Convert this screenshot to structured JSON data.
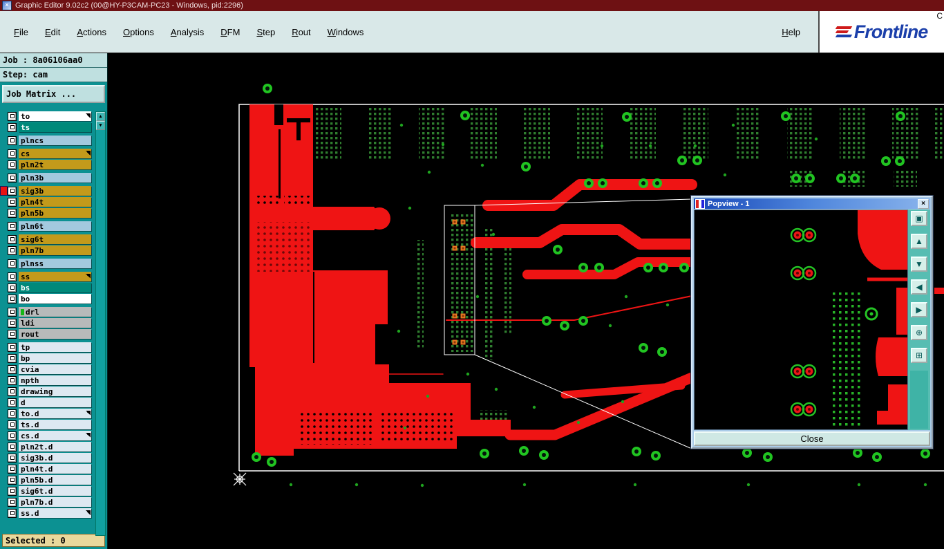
{
  "titlebar": {
    "title": "Graphic Editor 9.02c2 (00@HY-P3CAM-PC23 - Windows, pid:2296)"
  },
  "icons": {
    "app": "×",
    "close": "×",
    "scroll_up": "▲",
    "scroll_down": "▼"
  },
  "menubar": {
    "items": [
      {
        "label": "File",
        "key": "F"
      },
      {
        "label": "Edit",
        "key": "E"
      },
      {
        "label": "Actions",
        "key": "A"
      },
      {
        "label": "Options",
        "key": "O"
      },
      {
        "label": "Analysis",
        "key": "A"
      },
      {
        "label": "DFM",
        "key": "D"
      },
      {
        "label": "Step",
        "key": "S"
      },
      {
        "label": "Rout",
        "key": "R"
      },
      {
        "label": "Windows",
        "key": "W"
      }
    ],
    "help": {
      "label": "Help",
      "key": "H"
    }
  },
  "logo": {
    "brand": "Frontline",
    "partial": "C"
  },
  "sidebar": {
    "job_label": "Job : 8a06106aa0",
    "step_label": "Step: cam",
    "job_matrix_label": "Job Matrix ...",
    "selected_label": "Selected : 0",
    "colors": {
      "gold": "#c39a1b",
      "teal": "#00897a",
      "blue": "#a3c9de",
      "white": "#ffffff",
      "gray": "#b7baba",
      "pale": "#dde8f1"
    },
    "layers": [
      {
        "name": "to",
        "color": "white",
        "mark": true
      },
      {
        "name": "ts",
        "color": "teal",
        "fg": "#ffffff"
      },
      {
        "name": "plncs",
        "color": "blue",
        "gap": true
      },
      {
        "name": "cs",
        "color": "gold",
        "gap": true,
        "mark": true
      },
      {
        "name": "pln2t",
        "color": "gold"
      },
      {
        "name": "pln3b",
        "color": "blue",
        "gap": true
      },
      {
        "name": "sig3b",
        "color": "gold",
        "gap": true,
        "active": true
      },
      {
        "name": "pln4t",
        "color": "gold"
      },
      {
        "name": "pln5b",
        "color": "gold"
      },
      {
        "name": "pln6t",
        "color": "blue",
        "gap": true
      },
      {
        "name": "sig6t",
        "color": "gold",
        "gap": true
      },
      {
        "name": "pln7b",
        "color": "gold"
      },
      {
        "name": "plnss",
        "color": "blue",
        "gap": true
      },
      {
        "name": "ss",
        "color": "gold",
        "gap": true,
        "mark": true
      },
      {
        "name": "bs",
        "color": "teal",
        "fg": "#ffffff"
      },
      {
        "name": "bo",
        "color": "white"
      },
      {
        "name": "drl",
        "color": "gray",
        "gap": true,
        "chip": "#16b816"
      },
      {
        "name": "ldi",
        "color": "gray"
      },
      {
        "name": "rout",
        "color": "gray"
      },
      {
        "name": "tp",
        "color": "pale",
        "gap": true
      },
      {
        "name": "bp",
        "color": "pale"
      },
      {
        "name": "cvia",
        "color": "pale"
      },
      {
        "name": "npth",
        "color": "pale"
      },
      {
        "name": "drawing",
        "color": "pale"
      },
      {
        "name": "d",
        "color": "pale"
      },
      {
        "name": "to.d",
        "color": "pale",
        "mark": true
      },
      {
        "name": "ts.d",
        "color": "pale"
      },
      {
        "name": "cs.d",
        "color": "pale",
        "mark": true
      },
      {
        "name": "pln2t.d",
        "color": "pale"
      },
      {
        "name": "sig3b.d",
        "color": "pale"
      },
      {
        "name": "pln4t.d",
        "color": "pale"
      },
      {
        "name": "pln5b.d",
        "color": "pale"
      },
      {
        "name": "sig6t.d",
        "color": "pale"
      },
      {
        "name": "pln7b.d",
        "color": "pale"
      },
      {
        "name": "ss.d",
        "color": "pale",
        "mark": true
      }
    ]
  },
  "popview": {
    "title": "Popview - 1",
    "close_label": "Close",
    "tools": [
      {
        "name": "view-window-icon",
        "glyph": "▣"
      },
      {
        "name": "pan-up-icon",
        "glyph": "▲"
      },
      {
        "name": "pan-down-icon",
        "glyph": "▼"
      },
      {
        "name": "pan-left-icon",
        "glyph": "◀"
      },
      {
        "name": "pan-right-icon",
        "glyph": "▶"
      },
      {
        "name": "center-view-icon",
        "glyph": "⊕"
      },
      {
        "name": "zoom-fit-icon",
        "glyph": "⊞"
      }
    ]
  },
  "canvas_colors": {
    "copper": "#ef1414",
    "pad_green": "#21c421",
    "array_green": "#2f7e2f",
    "outline": "#ffffff"
  }
}
